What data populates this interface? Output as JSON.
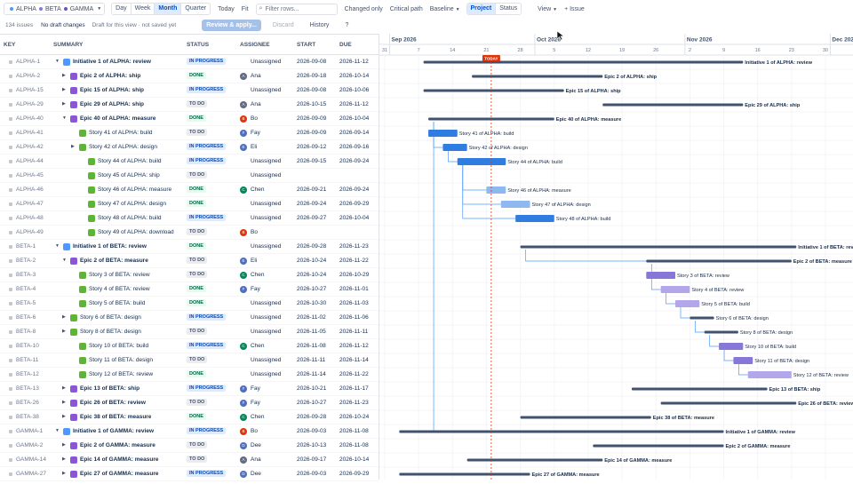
{
  "toolbar": {
    "projects": [
      {
        "name": "ALPHA",
        "color": "#4c9aff"
      },
      {
        "name": "BETA",
        "color": "#8777d9"
      },
      {
        "name": "GAMMA",
        "color": "#6554c0"
      }
    ],
    "views": [
      "Day",
      "Week",
      "Month",
      "Quarter"
    ],
    "active_view": "Month",
    "today": "Today",
    "fit": "Fit",
    "filter_placeholder": "Filter rows...",
    "changed_only": "Changed only",
    "critical_path": "Critical path",
    "baseline": "Baseline",
    "modes": [
      "Project",
      "Status"
    ],
    "active_mode": "Project",
    "view_menu": "View",
    "add_issue": "+ Issue"
  },
  "bar2": {
    "issue_count": "134 issues",
    "drafts": "No draft changes",
    "draft_note": "Draft for this view · not saved yet",
    "review": "Review & apply...",
    "discard": "Discard",
    "history": "History",
    "help": "?"
  },
  "columns": {
    "key": "KEY",
    "summary": "SUMMARY",
    "status": "STATUS",
    "assignee": "ASSIGNEE",
    "start": "START",
    "due": "DUE"
  },
  "months": [
    "Sep 2026",
    "Oct 2026",
    "Nov 2026",
    "Dec 2026"
  ],
  "day_ticks": [
    "31",
    "7",
    "14",
    "21",
    "28",
    "5",
    "12",
    "19",
    "26",
    "2",
    "9",
    "16",
    "23",
    "30"
  ],
  "today_label": "TODAY",
  "status_labels": {
    "ip": "IN PROGRESS",
    "dn": "DONE",
    "td": "TO DO"
  },
  "colors": {
    "initiative": "#4c9aff",
    "epic": "#8b55d8",
    "story": "#5eb439",
    "bar_dark": "#42526e",
    "alpha_bar": "#2f7de1",
    "beta_bar": "#8777d9",
    "today_line": "#de350b"
  },
  "rows": [
    {
      "key": "ALPHA-1",
      "summary": "Initiative 1 of ALPHA: review",
      "type": "initiative",
      "level": 0,
      "exp": "v",
      "status": "ip",
      "av": "",
      "ac": "",
      "asg": "Unassigned",
      "start": "2026-09-08",
      "due": "2026-11-12",
      "proj": "alpha"
    },
    {
      "key": "ALPHA-2",
      "summary": "Epic 2 of ALPHA: ship",
      "type": "epic",
      "level": 1,
      "exp": ">",
      "status": "dn",
      "av": "A",
      "ac": "#5e6c84",
      "asg": "Ana",
      "start": "2026-09-18",
      "due": "2026-10-14",
      "proj": "alpha"
    },
    {
      "key": "ALPHA-15",
      "summary": "Epic 15 of ALPHA: ship",
      "type": "epic",
      "level": 1,
      "exp": ">",
      "status": "ip",
      "av": "",
      "ac": "",
      "asg": "Unassigned",
      "start": "2026-09-08",
      "due": "2026-10-06",
      "proj": "alpha"
    },
    {
      "key": "ALPHA-29",
      "summary": "Epic 29 of ALPHA: ship",
      "type": "epic",
      "level": 1,
      "exp": ">",
      "status": "td",
      "av": "A",
      "ac": "#5e6c84",
      "asg": "Ana",
      "start": "2026-10-15",
      "due": "2026-11-12",
      "proj": "alpha"
    },
    {
      "key": "ALPHA-40",
      "summary": "Epic 40 of ALPHA: measure",
      "type": "epic",
      "level": 1,
      "exp": "v",
      "status": "dn",
      "av": "B",
      "ac": "#de350b",
      "asg": "Bo",
      "start": "2026-09-09",
      "due": "2026-10-04",
      "proj": "alpha"
    },
    {
      "key": "ALPHA-41",
      "summary": "Story 41 of ALPHA: build",
      "type": "story",
      "level": 2,
      "exp": "",
      "status": "td",
      "av": "F",
      "ac": "#4c6fbf",
      "asg": "Fay",
      "start": "2026-09-09",
      "due": "2026-09-14",
      "proj": "alpha"
    },
    {
      "key": "ALPHA-42",
      "summary": "Story 42 of ALPHA: design",
      "type": "story",
      "level": 2,
      "exp": ">",
      "status": "ip",
      "av": "E",
      "ac": "#4c6fbf",
      "asg": "Eli",
      "start": "2026-09-12",
      "due": "2026-09-16",
      "proj": "alpha"
    },
    {
      "key": "ALPHA-44",
      "summary": "Story 44 of ALPHA: build",
      "type": "story",
      "level": 3,
      "exp": "",
      "status": "ip",
      "av": "",
      "ac": "",
      "asg": "Unassigned",
      "start": "2026-09-15",
      "due": "2026-09-24",
      "proj": "alpha"
    },
    {
      "key": "ALPHA-45",
      "summary": "Story 45 of ALPHA: ship",
      "type": "story",
      "level": 3,
      "exp": "",
      "status": "td",
      "av": "",
      "ac": "",
      "asg": "Unassigned",
      "start": "",
      "due": "",
      "proj": "alpha"
    },
    {
      "key": "ALPHA-46",
      "summary": "Story 46 of ALPHA: measure",
      "type": "story",
      "level": 3,
      "exp": "",
      "status": "dn",
      "av": "C",
      "ac": "#00875a",
      "asg": "Chen",
      "start": "2026-09-21",
      "due": "2026-09-24",
      "proj": "alpha"
    },
    {
      "key": "ALPHA-47",
      "summary": "Story 47 of ALPHA: design",
      "type": "story",
      "level": 3,
      "exp": "",
      "status": "dn",
      "av": "",
      "ac": "",
      "asg": "Unassigned",
      "start": "2026-09-24",
      "due": "2026-09-29",
      "proj": "alpha"
    },
    {
      "key": "ALPHA-48",
      "summary": "Story 48 of ALPHA: build",
      "type": "story",
      "level": 3,
      "exp": "",
      "status": "ip",
      "av": "",
      "ac": "",
      "asg": "Unassigned",
      "start": "2026-09-27",
      "due": "2026-10-04",
      "proj": "alpha"
    },
    {
      "key": "ALPHA-49",
      "summary": "Story 49 of ALPHA: download",
      "type": "story",
      "level": 3,
      "exp": "",
      "status": "td",
      "av": "B",
      "ac": "#de350b",
      "asg": "Bo",
      "start": "",
      "due": "",
      "proj": "alpha"
    },
    {
      "key": "BETA-1",
      "summary": "Initiative 1 of BETA: review",
      "type": "initiative",
      "level": 0,
      "exp": "v",
      "status": "dn",
      "av": "",
      "ac": "",
      "asg": "Unassigned",
      "start": "2026-09-28",
      "due": "2026-11-23",
      "proj": "beta"
    },
    {
      "key": "BETA-2",
      "summary": "Epic 2 of BETA: measure",
      "type": "epic",
      "level": 1,
      "exp": "v",
      "status": "td",
      "av": "E",
      "ac": "#4c6fbf",
      "asg": "Eli",
      "start": "2026-10-24",
      "due": "2026-11-22",
      "proj": "beta"
    },
    {
      "key": "BETA-3",
      "summary": "Story 3 of BETA: review",
      "type": "story",
      "level": 2,
      "exp": "",
      "status": "td",
      "av": "C",
      "ac": "#00875a",
      "asg": "Chen",
      "start": "2026-10-24",
      "due": "2026-10-29",
      "proj": "beta"
    },
    {
      "key": "BETA-4",
      "summary": "Story 4 of BETA: review",
      "type": "story",
      "level": 2,
      "exp": "",
      "status": "dn",
      "av": "F",
      "ac": "#4c6fbf",
      "asg": "Fay",
      "start": "2026-10-27",
      "due": "2026-11-01",
      "proj": "beta"
    },
    {
      "key": "BETA-5",
      "summary": "Story 5 of BETA: build",
      "type": "story",
      "level": 2,
      "exp": "",
      "status": "dn",
      "av": "",
      "ac": "",
      "asg": "Unassigned",
      "start": "2026-10-30",
      "due": "2026-11-03",
      "proj": "beta"
    },
    {
      "key": "BETA-6",
      "summary": "Story 6 of BETA: design",
      "type": "story",
      "level": 1,
      "exp": ">",
      "status": "ip",
      "av": "",
      "ac": "",
      "asg": "Unassigned",
      "start": "2026-11-02",
      "due": "2026-11-06",
      "proj": "beta"
    },
    {
      "key": "BETA-8",
      "summary": "Story 8 of BETA: design",
      "type": "story",
      "level": 1,
      "exp": ">",
      "status": "td",
      "av": "",
      "ac": "",
      "asg": "Unassigned",
      "start": "2026-11-05",
      "due": "2026-11-11",
      "proj": "beta"
    },
    {
      "key": "BETA-10",
      "summary": "Story 10 of BETA: build",
      "type": "story",
      "level": 2,
      "exp": "",
      "status": "ip",
      "av": "C",
      "ac": "#00875a",
      "asg": "Chen",
      "start": "2026-11-08",
      "due": "2026-11-12",
      "proj": "beta"
    },
    {
      "key": "BETA-11",
      "summary": "Story 11 of BETA: design",
      "type": "story",
      "level": 2,
      "exp": "",
      "status": "td",
      "av": "",
      "ac": "",
      "asg": "Unassigned",
      "start": "2026-11-11",
      "due": "2026-11-14",
      "proj": "beta"
    },
    {
      "key": "BETA-12",
      "summary": "Story 12 of BETA: review",
      "type": "story",
      "level": 2,
      "exp": "",
      "status": "dn",
      "av": "",
      "ac": "",
      "asg": "Unassigned",
      "start": "2026-11-14",
      "due": "2026-11-22",
      "proj": "beta"
    },
    {
      "key": "BETA-13",
      "summary": "Epic 13 of BETA: ship",
      "type": "epic",
      "level": 1,
      "exp": ">",
      "status": "ip",
      "av": "F",
      "ac": "#4c6fbf",
      "asg": "Fay",
      "start": "2026-10-21",
      "due": "2026-11-17",
      "proj": "beta"
    },
    {
      "key": "BETA-26",
      "summary": "Epic 26 of BETA: review",
      "type": "epic",
      "level": 1,
      "exp": ">",
      "status": "td",
      "av": "F",
      "ac": "#4c6fbf",
      "asg": "Fay",
      "start": "2026-10-27",
      "due": "2026-11-23",
      "proj": "beta"
    },
    {
      "key": "BETA-38",
      "summary": "Epic 38 of BETA: measure",
      "type": "epic",
      "level": 1,
      "exp": ">",
      "status": "dn",
      "av": "C",
      "ac": "#00875a",
      "asg": "Chen",
      "start": "2026-09-28",
      "due": "2026-10-24",
      "proj": "beta"
    },
    {
      "key": "GAMMA-1",
      "summary": "Initiative 1 of GAMMA: review",
      "type": "initiative",
      "level": 0,
      "exp": "v",
      "status": "ip",
      "av": "B",
      "ac": "#de350b",
      "asg": "Bo",
      "start": "2026-09-03",
      "due": "2026-11-08",
      "proj": "gamma"
    },
    {
      "key": "GAMMA-2",
      "summary": "Epic 2 of GAMMA: measure",
      "type": "epic",
      "level": 1,
      "exp": ">",
      "status": "td",
      "av": "D",
      "ac": "#4c6fbf",
      "asg": "Dee",
      "start": "2026-10-13",
      "due": "2026-11-08",
      "proj": "gamma"
    },
    {
      "key": "GAMMA-14",
      "summary": "Epic 14 of GAMMA: measure",
      "type": "epic",
      "level": 1,
      "exp": ">",
      "status": "td",
      "av": "A",
      "ac": "#5e6c84",
      "asg": "Ana",
      "start": "2026-09-17",
      "due": "2026-10-14",
      "proj": "gamma"
    },
    {
      "key": "GAMMA-27",
      "summary": "Epic 27 of GAMMA: measure",
      "type": "epic",
      "level": 1,
      "exp": ">",
      "status": "ip",
      "av": "D",
      "ac": "#4c6fbf",
      "asg": "Dee",
      "start": "2026-09-03",
      "due": "2026-09-29",
      "proj": "gamma"
    }
  ]
}
